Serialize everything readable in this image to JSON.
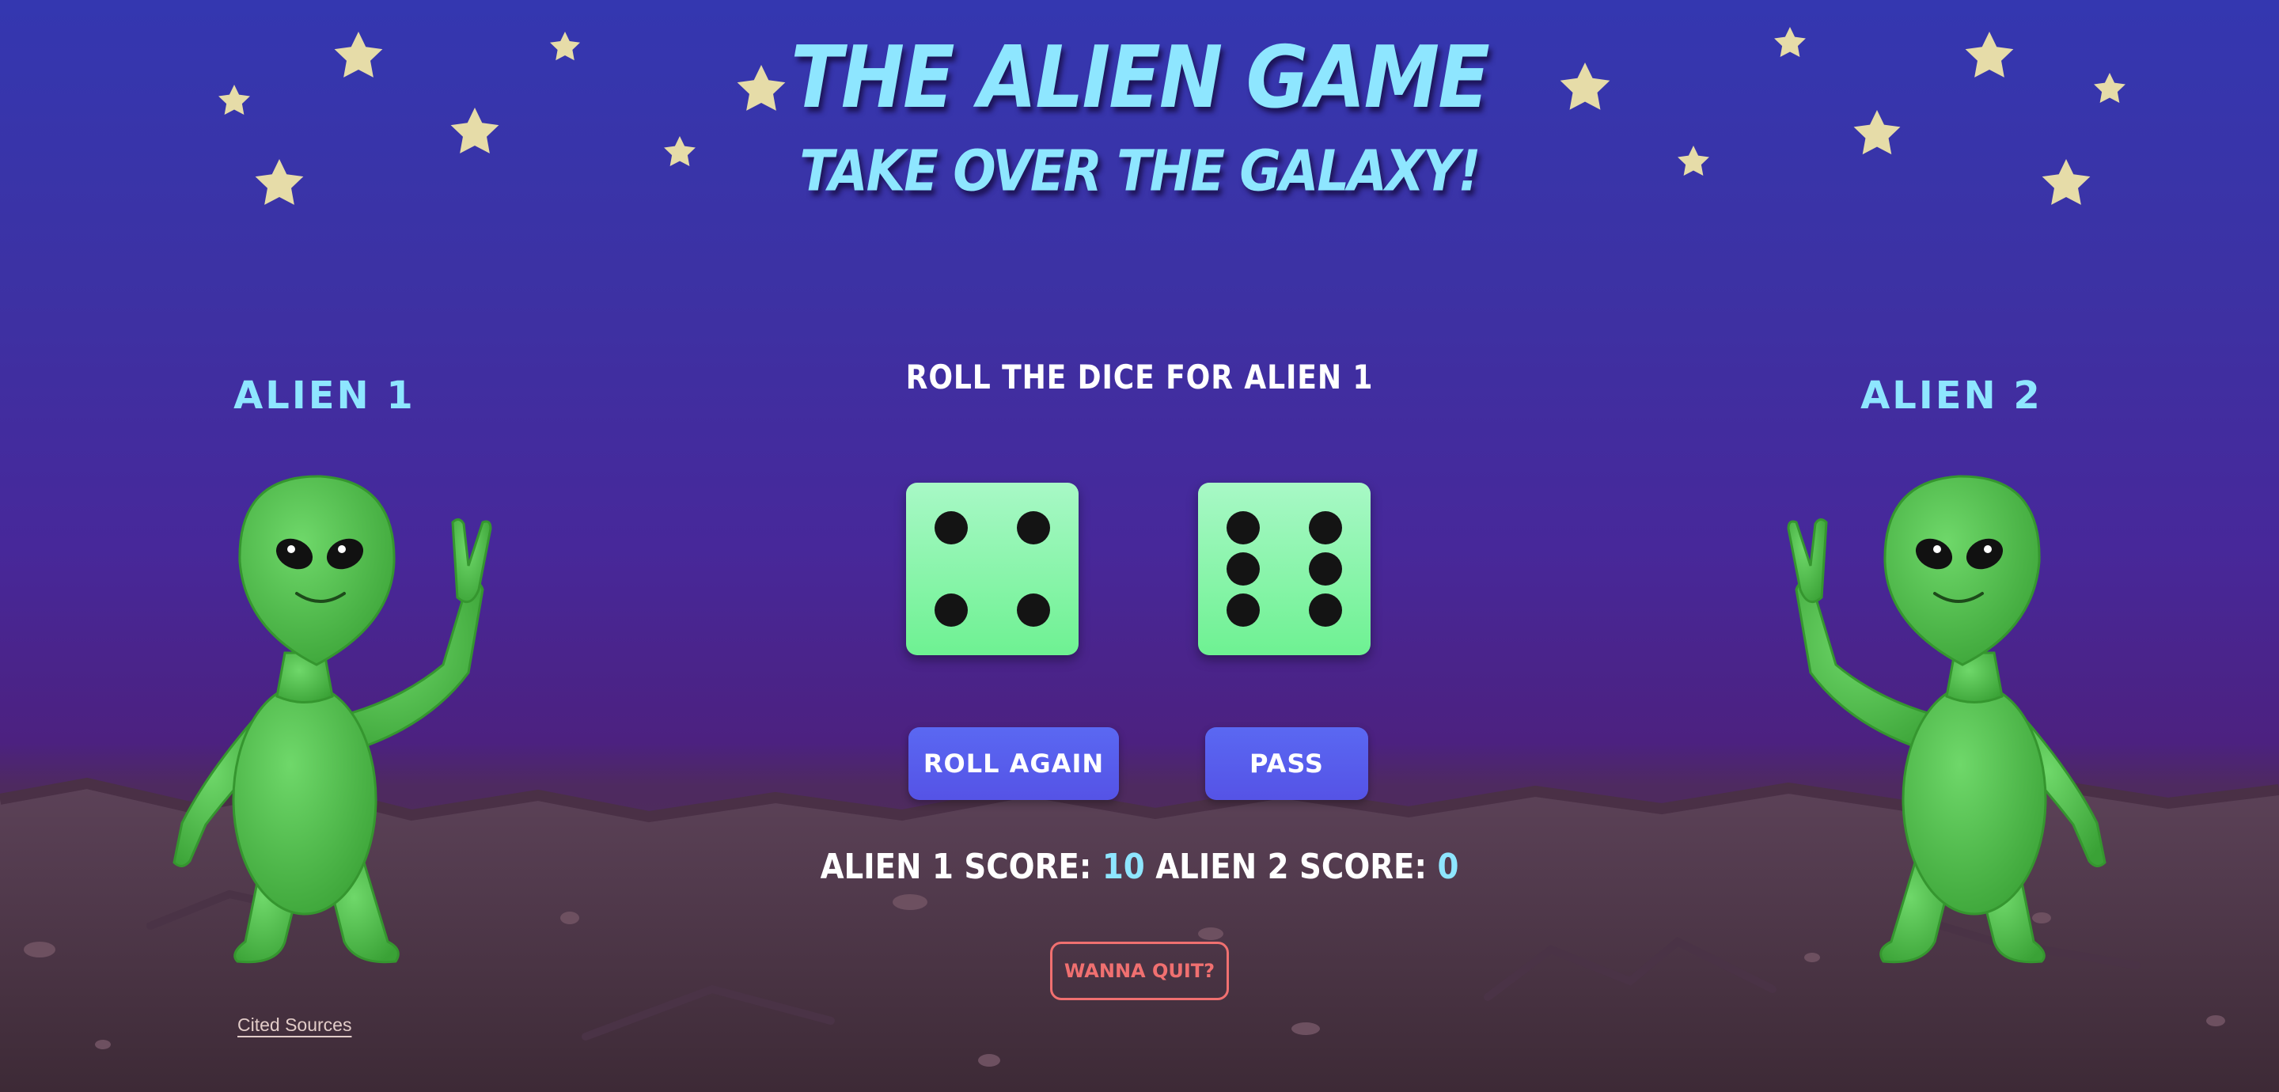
{
  "header": {
    "title": "THE ALIEN GAME",
    "subtitle": "TAKE OVER THE GALAXY!"
  },
  "players": {
    "left_label": "ALIEN 1",
    "right_label": "ALIEN 2"
  },
  "game": {
    "status": "ROLL THE DICE FOR ALIEN 1",
    "dice": [
      4,
      6
    ],
    "roll_label": "ROLL AGAIN",
    "pass_label": "PASS"
  },
  "scoreboard": {
    "alien1_label": "ALIEN 1 SCORE:",
    "alien1_score": "10",
    "alien2_label": "ALIEN 2 SCORE:",
    "alien2_score": "0"
  },
  "quit_label": "WANNA QUIT?",
  "footer": {
    "cited_label": "Cited Sources"
  },
  "colors": {
    "accent_cyan": "#8ee6ff",
    "button_blue": "#5a5ff0",
    "dice_green": "#7ef5a3",
    "quit_red": "#f07070"
  },
  "icons": [
    "star-icon",
    "alien-figure",
    "dice"
  ]
}
